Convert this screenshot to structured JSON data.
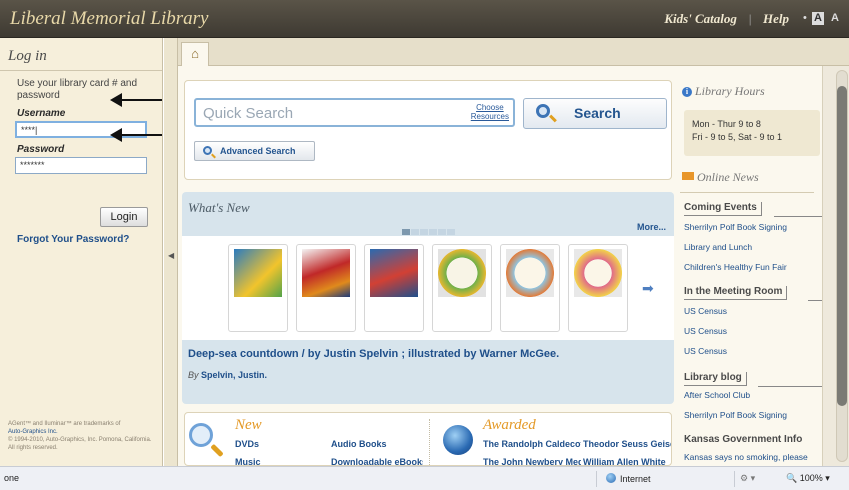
{
  "header": {
    "brand": "Liberal Memorial Library",
    "links": [
      "Kids' Catalog",
      "Help"
    ],
    "font_size_controls": [
      "A",
      "A"
    ]
  },
  "login": {
    "title": "Log in",
    "hint": "Use your library card # and password",
    "username_label": "Username",
    "username_value": "****|",
    "password_label": "Password",
    "password_value": "*******",
    "login_button": "Login",
    "forgot_link": "Forgot Your Password?",
    "legal_1": "AGent™ and Iluminar™ are trademarks of",
    "legal_2": "Auto-Graphics Inc.",
    "legal_3": "© 1994-2010, Auto-Graphics, Inc. Pomona, California. All rights reserved."
  },
  "tabs": {
    "home_icon": "home-icon"
  },
  "search": {
    "placeholder": "Quick Search",
    "choose_1": "Choose",
    "choose_2": "Resources",
    "search_button": "Search",
    "advanced_button": "Advanced Search"
  },
  "whats_new": {
    "title": "What's New",
    "more": "More...",
    "books": [
      "cover-1",
      "cover-2",
      "cover-3",
      "cover-4",
      "cover-5",
      "cover-6"
    ],
    "featured_title": "Deep-sea countdown /  by Justin Spelvin ; illustrated by Warner McGee.",
    "by_label": "By",
    "featured_author": "Spelvin, Justin."
  },
  "sections": {
    "new_title": "New",
    "new_links": [
      "DVDs",
      "Audio Books",
      "Music",
      "Downloadable eBooks"
    ],
    "awarded_title": "Awarded",
    "awarded_links": [
      "The Randolph Caldecott Medal",
      "Theodor Seuss Geisel",
      "The John Newbery Medal",
      "William Allen White"
    ]
  },
  "sidebar": {
    "hours_title": "Library Hours",
    "hours_1": "Mon - Thur 9 to 8",
    "hours_2": "Fri - 9 to 5, Sat - 9 to 1",
    "news_title": "Online News",
    "coming_events_title": "Coming Events",
    "coming_events": [
      "Sherrilyn Polf Book Signing",
      "Library and Lunch",
      "Children's Healthy Fun Fair"
    ],
    "meeting_room_title": "In the Meeting Room",
    "meeting_room": [
      "US Census",
      "US Census",
      "US Census"
    ],
    "blog_title": "Library blog",
    "blog": [
      "After School Club",
      "Sherrilyn Polf Book Signing"
    ],
    "kansas_title": "Kansas Government Info",
    "kansas": [
      "Kansas says no smoking, please"
    ]
  },
  "statusbar": {
    "left": "one",
    "zone": "Internet",
    "zoom": "100%"
  },
  "colors": {
    "header_bg": "#4a453b",
    "brand_text": "#e8d8a8",
    "link_blue": "#1f4f8a",
    "accent_orange": "#e49a28",
    "panel_bg": "#f6efdb",
    "whats_new_bg": "#d7e4ec"
  }
}
